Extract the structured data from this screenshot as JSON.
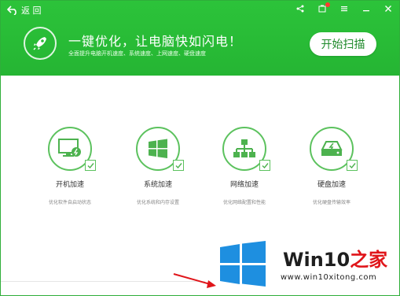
{
  "titlebar": {
    "back_label": "返 回"
  },
  "banner": {
    "headline": "一键优化，让电脑快如闪电！",
    "subline": "全面提升电脑开机速度、系统速度、上网速度、硬盘速度",
    "scan_button": "开始扫描"
  },
  "items": [
    {
      "title": "开机加速",
      "desc": "优化软件自启动状态",
      "icon": "monitor-power-icon"
    },
    {
      "title": "系统加速",
      "desc": "优化系统和内存设置",
      "icon": "windows-logo-icon"
    },
    {
      "title": "网络加速",
      "desc": "优化网络配置和性能",
      "icon": "network-icon"
    },
    {
      "title": "硬盘加速",
      "desc": "优化硬盘传输效率",
      "icon": "harddisk-icon"
    }
  ],
  "watermark": {
    "brand_latin": "Win10",
    "brand_cn": "之家",
    "site": "www.win10xitong.com"
  },
  "colors": {
    "header_green": "#27bb36",
    "accent_green": "#5cc25e",
    "button_text": "#1f8a2b",
    "watermark_blue": "#1e8fe0",
    "watermark_red": "#e0151a"
  }
}
